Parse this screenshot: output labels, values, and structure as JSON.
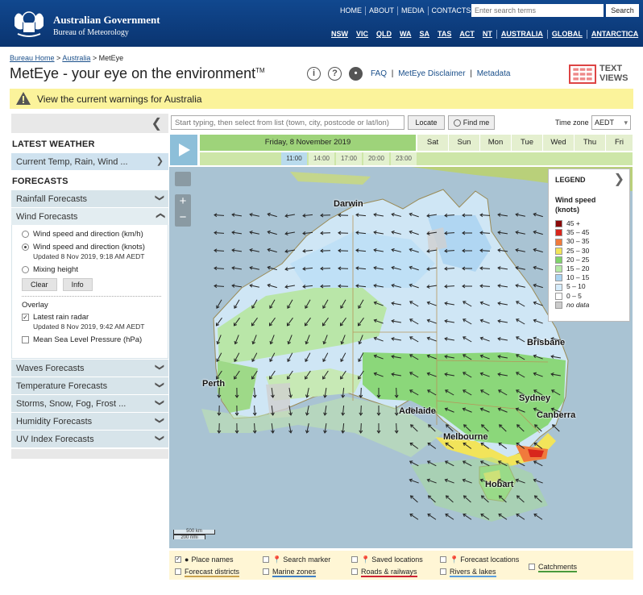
{
  "header": {
    "gov_line1": "Australian Government",
    "gov_line2": "Bureau of Meteorology",
    "top_nav": [
      "HOME",
      "ABOUT",
      "MEDIA",
      "CONTACTS"
    ],
    "search_placeholder": "Enter search terms",
    "search_button": "Search",
    "state_nav": [
      "NSW",
      "VIC",
      "QLD",
      "WA",
      "SA",
      "TAS",
      "ACT",
      "NT",
      "AUSTRALIA",
      "GLOBAL",
      "ANTARCTICA"
    ]
  },
  "breadcrumb": {
    "home": "Bureau Home",
    "australia": "Australia",
    "current": "MetEye",
    "sep": ">"
  },
  "title": {
    "main": "MetEye",
    "dash": " - ",
    "tagline": "your eye on the environment",
    "tm": "TM"
  },
  "info_links": [
    "FAQ",
    "MetEye Disclaimer",
    "Metadata"
  ],
  "text_views": [
    "TEXT",
    "VIEWS"
  ],
  "warning": "View the current warnings for Australia",
  "sidebar": {
    "latest_heading": "LATEST WEATHER",
    "latest_item": "Current Temp, Rain, Wind ...",
    "forecasts_heading": "FORECASTS",
    "rainfall": "Rainfall Forecasts",
    "wind": "Wind Forecasts",
    "wind_options": [
      "Wind speed and direction (km/h)",
      "Wind speed and direction (knots)",
      "Mixing height"
    ],
    "wind_updated": "Updated 8 Nov 2019, 9:18 AM AEDT",
    "clear": "Clear",
    "info": "Info",
    "overlay_heading": "Overlay",
    "overlay_radar": "Latest rain radar",
    "radar_updated": "Updated 8 Nov 2019, 9:42 AM AEDT",
    "overlay_mslp": "Mean Sea Level Pressure (hPa)",
    "others": [
      "Waves Forecasts",
      "Temperature Forecasts",
      "Storms, Snow, Fog, Frost ...",
      "Humidity Forecasts",
      "UV Index Forecasts"
    ]
  },
  "controls": {
    "location_placeholder": "Start typing, then select from list (town, city, postcode or lat/lon)",
    "locate": "Locate",
    "find_me": "Find me",
    "timezone_label": "Time zone",
    "timezone": "AEDT"
  },
  "timeline": {
    "current_day": "Friday, 8 November 2019",
    "days": [
      "Sat",
      "Sun",
      "Mon",
      "Tue",
      "Wed",
      "Thu",
      "Fri"
    ],
    "hours": [
      "11:00",
      "14:00",
      "17:00",
      "20:00",
      "23:00"
    ],
    "selected_hour": 0
  },
  "map": {
    "cities": [
      "Darwin",
      "Brisbane",
      "Perth",
      "Adelaide",
      "Sydney",
      "Canberra",
      "Melbourne",
      "Hobart"
    ],
    "scale_km": "500 km",
    "scale_nmi": "200 nmi"
  },
  "legend": {
    "title": "LEGEND",
    "subtitle1": "Wind speed",
    "subtitle2": "(knots)",
    "rows": [
      {
        "label": "45 +",
        "color": "#8b0a0a"
      },
      {
        "label": "35 – 45",
        "color": "#d8261c"
      },
      {
        "label": "30 – 35",
        "color": "#f07a3c"
      },
      {
        "label": "25 – 30",
        "color": "#f2e45a"
      },
      {
        "label": "20 – 25",
        "color": "#7fd36a"
      },
      {
        "label": "15 – 20",
        "color": "#b5e8a6"
      },
      {
        "label": "10 – 15",
        "color": "#a9d3f1"
      },
      {
        "label": "5 – 10",
        "color": "#d6ecfb"
      },
      {
        "label": "0 – 5",
        "color": "#ffffff"
      },
      {
        "label": "no data",
        "color": "#cccccc"
      }
    ]
  },
  "layers": {
    "row1": [
      "Place names",
      "Search marker",
      "Saved locations",
      "Forecast locations"
    ],
    "row2": [
      "Forecast districts",
      "Marine zones",
      "Roads & railways",
      "Rivers & lakes",
      "Catchments"
    ]
  }
}
